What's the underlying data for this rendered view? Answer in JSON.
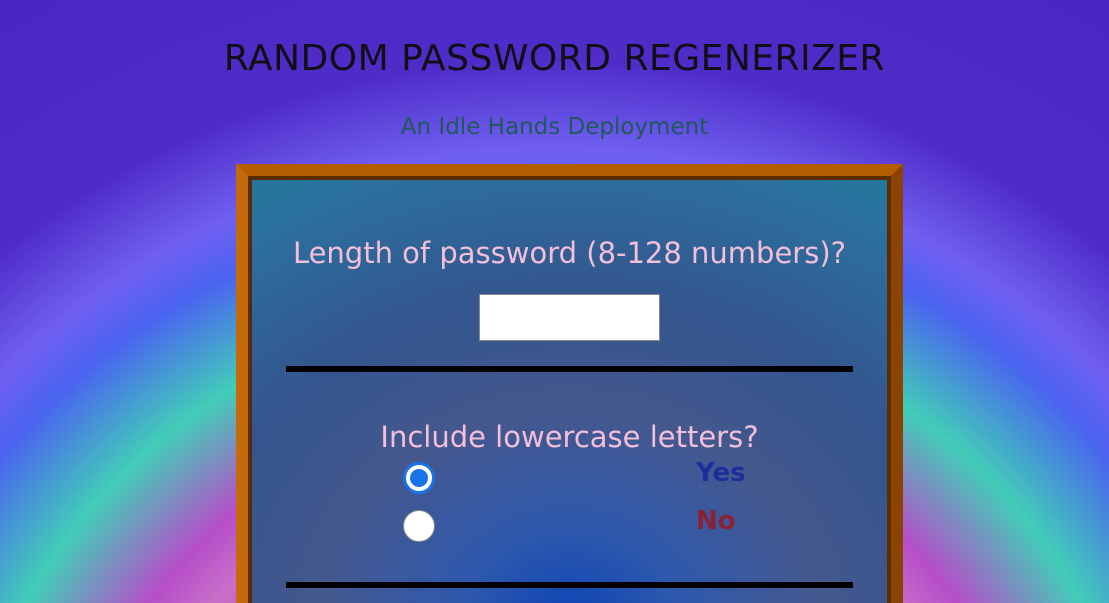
{
  "header": {
    "title": "RANDOM PASSWORD REGENERIZER",
    "subtitle": "An Idle Hands Deployment"
  },
  "form": {
    "length_question": "Length of password (8-128 numbers)?",
    "length_value": "",
    "lowercase_question": "Include lowercase letters?",
    "lowercase_options": [
      {
        "label": "Yes",
        "selected": true
      },
      {
        "label": "No",
        "selected": false
      }
    ]
  },
  "colors": {
    "frame_border": "#b35c00",
    "question_text": "#f4bfd8",
    "yes_label": "#1d2e9c",
    "no_label": "#8a2233",
    "radio_accent": "#1a73e8"
  }
}
